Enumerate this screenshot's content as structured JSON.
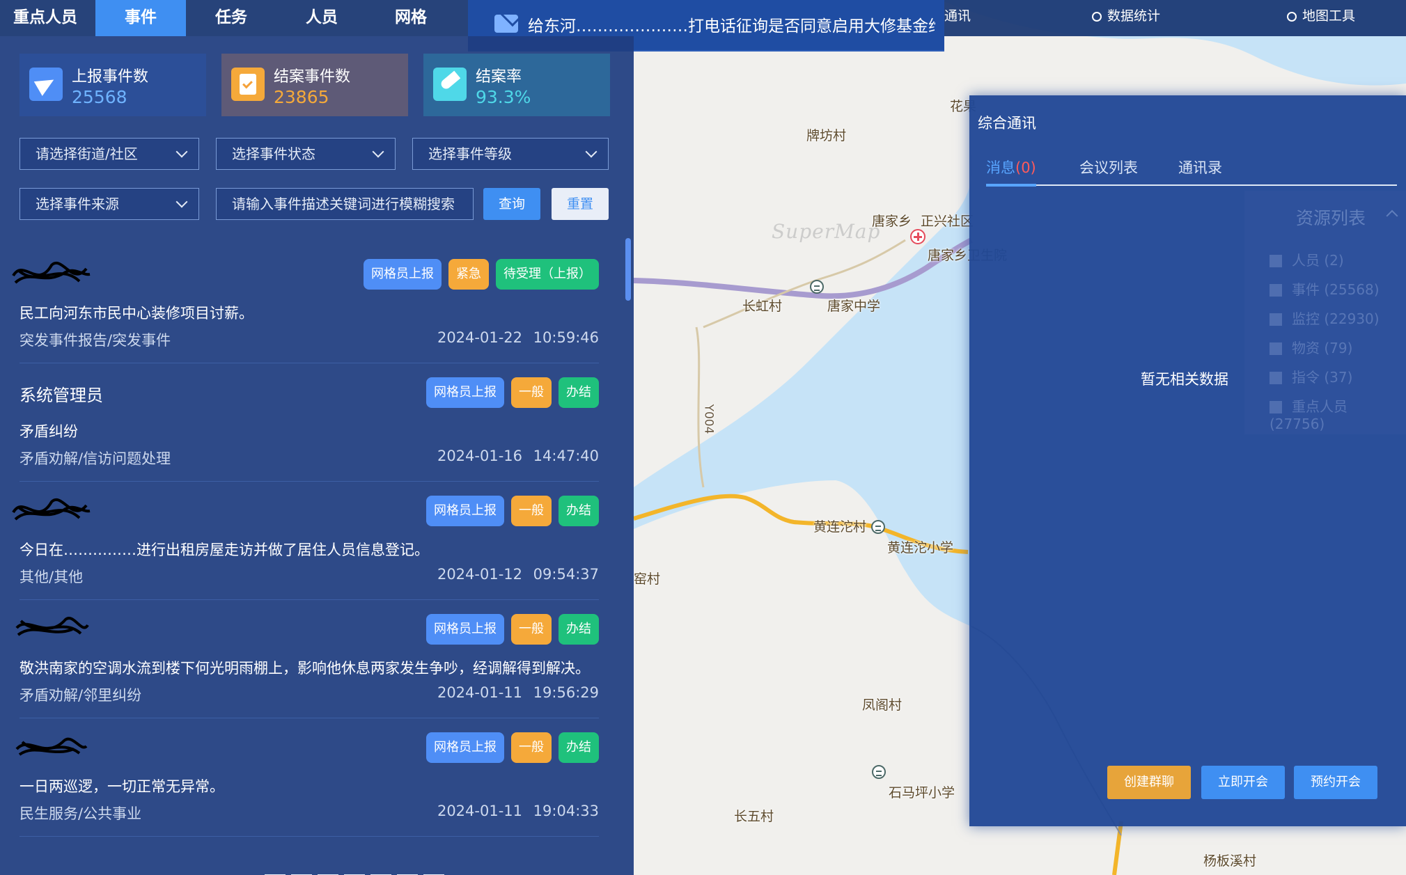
{
  "nav": {
    "tabs": [
      {
        "label": "重点人员"
      },
      {
        "label": "事件"
      },
      {
        "label": "任务"
      },
      {
        "label": "人员"
      },
      {
        "label": "网格"
      }
    ],
    "active_tab": 1
  },
  "notice": {
    "text": "给东河…………………打电话征询是否同意启用大修基金维护消防设"
  },
  "top_tools": {
    "comm_label": "通讯",
    "stats_label": "数据统计",
    "map_tools_label": "地图工具"
  },
  "stats": [
    {
      "label": "上报事件数",
      "value": "25568",
      "color": "#6fb3ff",
      "icon": "paper-plane-icon"
    },
    {
      "label": "结案事件数",
      "value": "23865",
      "color": "#f5a93a",
      "icon": "clipboard-icon"
    },
    {
      "label": "结案率",
      "value": "93.3%",
      "color": "#4fd8e8",
      "icon": "rocket-icon"
    }
  ],
  "filters": {
    "street": "请选择街道/社区",
    "status": "选择事件状态",
    "level": "选择事件等级",
    "source": "选择事件来源",
    "keyword_placeholder": "请输入事件描述关键词进行模糊搜索",
    "query_label": "查询",
    "reset_label": "重置"
  },
  "events": [
    {
      "reporter": "",
      "tags": [
        "网格员上报",
        "紧急",
        "待受理（上报）"
      ],
      "desc": "民工向河东市民中心装修项目讨薪。",
      "category": "突发事件报告/突发事件",
      "date": "2024-01-22",
      "time": "10:59:46"
    },
    {
      "reporter": "系统管理员",
      "tags": [
        "网格员上报",
        "一般",
        "办结"
      ],
      "desc": "矛盾纠纷",
      "category": "矛盾劝解/信访问题处理",
      "date": "2024-01-16",
      "time": "14:47:40"
    },
    {
      "reporter": "",
      "tags": [
        "网格员上报",
        "一般",
        "办结"
      ],
      "desc": "今日在……………进行出租房屋走访并做了居住人员信息登记。",
      "category": "其他/其他",
      "date": "2024-01-12",
      "time": "09:54:37"
    },
    {
      "reporter": "",
      "tags": [
        "网格员上报",
        "一般",
        "办结"
      ],
      "desc": "敬洪南家的空调水流到楼下何光明雨棚上，影响他休息两家发生争吵，经调解得到解决。",
      "category": "矛盾劝解/邻里纠纷",
      "date": "2024-01-11",
      "time": "19:56:29"
    },
    {
      "reporter": "",
      "tags": [
        "网格员上报",
        "一般",
        "办结"
      ],
      "desc": "一日两巡逻，一切正常无异常。",
      "category": "民生服务/公共事业",
      "date": "2024-01-11",
      "time": "19:04:33"
    }
  ],
  "comm": {
    "title": "综合通讯",
    "tabs": {
      "messages": "消息",
      "messages_count": "(0)",
      "meetings": "会议列表",
      "contacts": "通讯录"
    },
    "empty": "暂无相关数据",
    "buttons": {
      "group_chat": "创建群聊",
      "start_meeting": "立即开会",
      "schedule_meeting": "预约开会"
    }
  },
  "resources": {
    "title": "资源列表",
    "items": [
      {
        "label": "人员 (2)"
      },
      {
        "label": "事件 (25568)"
      },
      {
        "label": "监控 (22930)"
      },
      {
        "label": "物资 (79)"
      },
      {
        "label": "指令 (37)"
      },
      {
        "label": "重点人员 (27756)"
      }
    ]
  },
  "map": {
    "watermark": "SuperMap",
    "labels": [
      "牌坊村",
      "唐家乡",
      "正兴社区",
      "唐家乡卫生院",
      "长虹村",
      "唐家中学",
      "Y004",
      "黄连沱村",
      "黄连沱小学",
      "凤阁村",
      "石马坪小学",
      "长五村",
      "杨板溪村",
      "花果",
      "窑村"
    ]
  },
  "colors": {
    "accent": "#3f8ff2",
    "tag_blue": "#4f8ef6",
    "tag_orange": "#f5a93a",
    "tag_green": "#1fc17c",
    "river": "#c6e3f7",
    "road_yellow": "#f3b52a",
    "road_purple": "#a79bcf"
  }
}
